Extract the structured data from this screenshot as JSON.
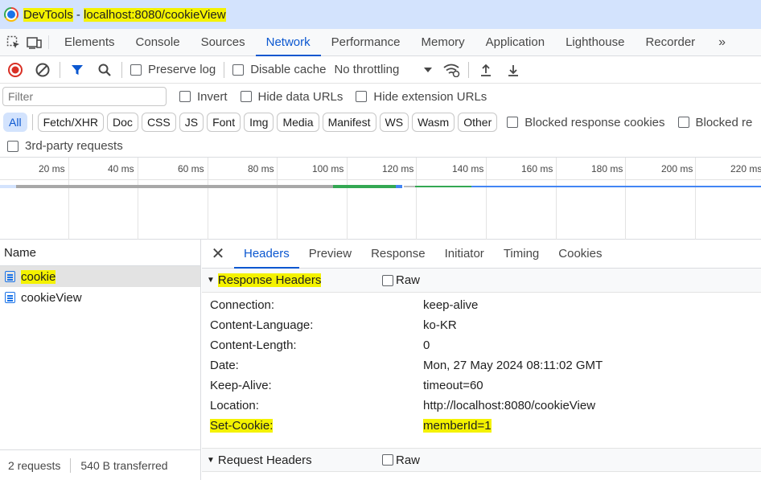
{
  "window": {
    "title_app": "DevTools",
    "title_sep": " - ",
    "title_url": "localhost:8080/cookieView"
  },
  "tabs": [
    {
      "label": "Elements"
    },
    {
      "label": "Console"
    },
    {
      "label": "Sources"
    },
    {
      "label": "Network"
    },
    {
      "label": "Performance"
    },
    {
      "label": "Memory"
    },
    {
      "label": "Application"
    },
    {
      "label": "Lighthouse"
    },
    {
      "label": "Recorder"
    }
  ],
  "tabs_more": "»",
  "toolbar": {
    "preserve_log": "Preserve log",
    "disable_cache": "Disable cache",
    "throttling": "No throttling"
  },
  "filter": {
    "placeholder": "Filter",
    "invert": "Invert",
    "hide_data_urls": "Hide data URLs",
    "hide_extension_urls": "Hide extension URLs"
  },
  "types": [
    "All",
    "Fetch/XHR",
    "Doc",
    "CSS",
    "JS",
    "Font",
    "Img",
    "Media",
    "Manifest",
    "WS",
    "Wasm",
    "Other"
  ],
  "type_checks": {
    "blocked_response_cookies": "Blocked response cookies",
    "blocked_requests": "Blocked re"
  },
  "third_party": "3rd-party requests",
  "timeline_ticks": [
    "20 ms",
    "40 ms",
    "60 ms",
    "80 ms",
    "100 ms",
    "120 ms",
    "140 ms",
    "160 ms",
    "180 ms",
    "200 ms",
    "220 ms"
  ],
  "request_list": {
    "header": "Name",
    "items": [
      {
        "name": "cookie"
      },
      {
        "name": "cookieView"
      }
    ],
    "footer_requests": "2 requests",
    "footer_transferred": "540 B transferred"
  },
  "details": {
    "tabs": [
      "Headers",
      "Preview",
      "Response",
      "Initiator",
      "Timing",
      "Cookies"
    ],
    "response_headers_title": "Response Headers",
    "raw_label": "Raw",
    "response_headers": [
      {
        "name": "Connection:",
        "value": "keep-alive"
      },
      {
        "name": "Content-Language:",
        "value": "ko-KR"
      },
      {
        "name": "Content-Length:",
        "value": "0"
      },
      {
        "name": "Date:",
        "value": "Mon, 27 May 2024 08:11:02 GMT"
      },
      {
        "name": "Keep-Alive:",
        "value": "timeout=60"
      },
      {
        "name": "Location:",
        "value": "http://localhost:8080/cookieView"
      },
      {
        "name": "Set-Cookie:",
        "value": "memberId=1"
      }
    ],
    "request_headers_title": "Request Headers"
  },
  "colors": {
    "accent": "#0b57d0",
    "highlight": "#f4f200",
    "record": "#d93025"
  }
}
